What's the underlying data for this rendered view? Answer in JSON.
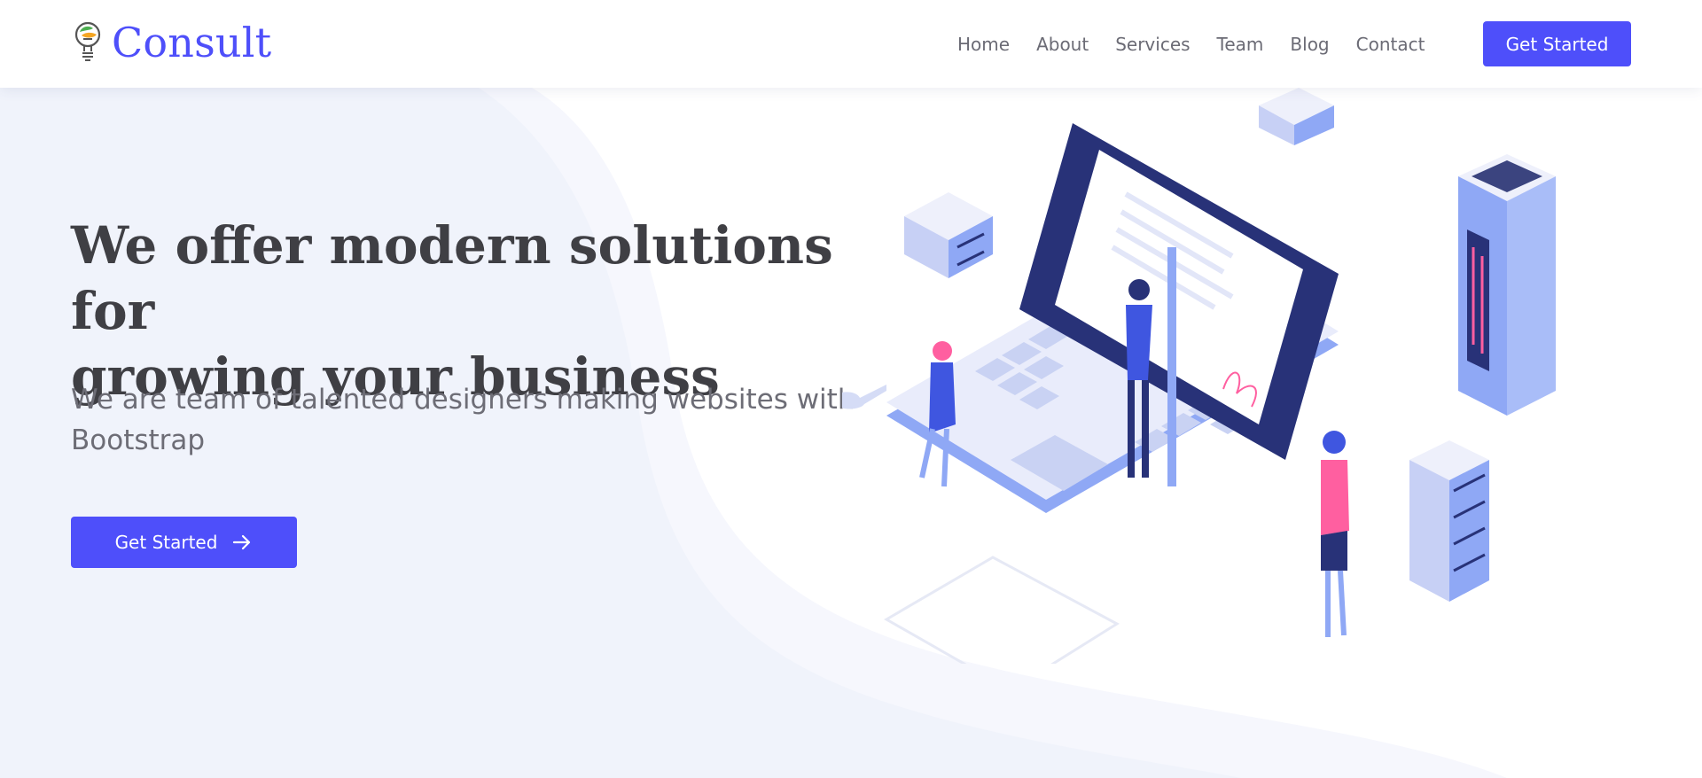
{
  "header": {
    "brand": "Consult",
    "nav": [
      {
        "label": "Home"
      },
      {
        "label": "About"
      },
      {
        "label": "Services"
      },
      {
        "label": "Team"
      },
      {
        "label": "Blog"
      },
      {
        "label": "Contact"
      }
    ],
    "cta_label": "Get Started"
  },
  "hero": {
    "title_line1": "We offer modern solutions for",
    "title_line2": "growing your business",
    "subtitle_line1": "We are team of talented designers making websites with",
    "subtitle_line2": "Bootstrap",
    "cta_label": "Get Started",
    "cta_icon": "arrow-right-icon"
  },
  "colors": {
    "accent": "#4e4ffa",
    "heading": "#3f3f44",
    "text": "#6d6d76",
    "hero_bg": "#f1f4fc"
  }
}
